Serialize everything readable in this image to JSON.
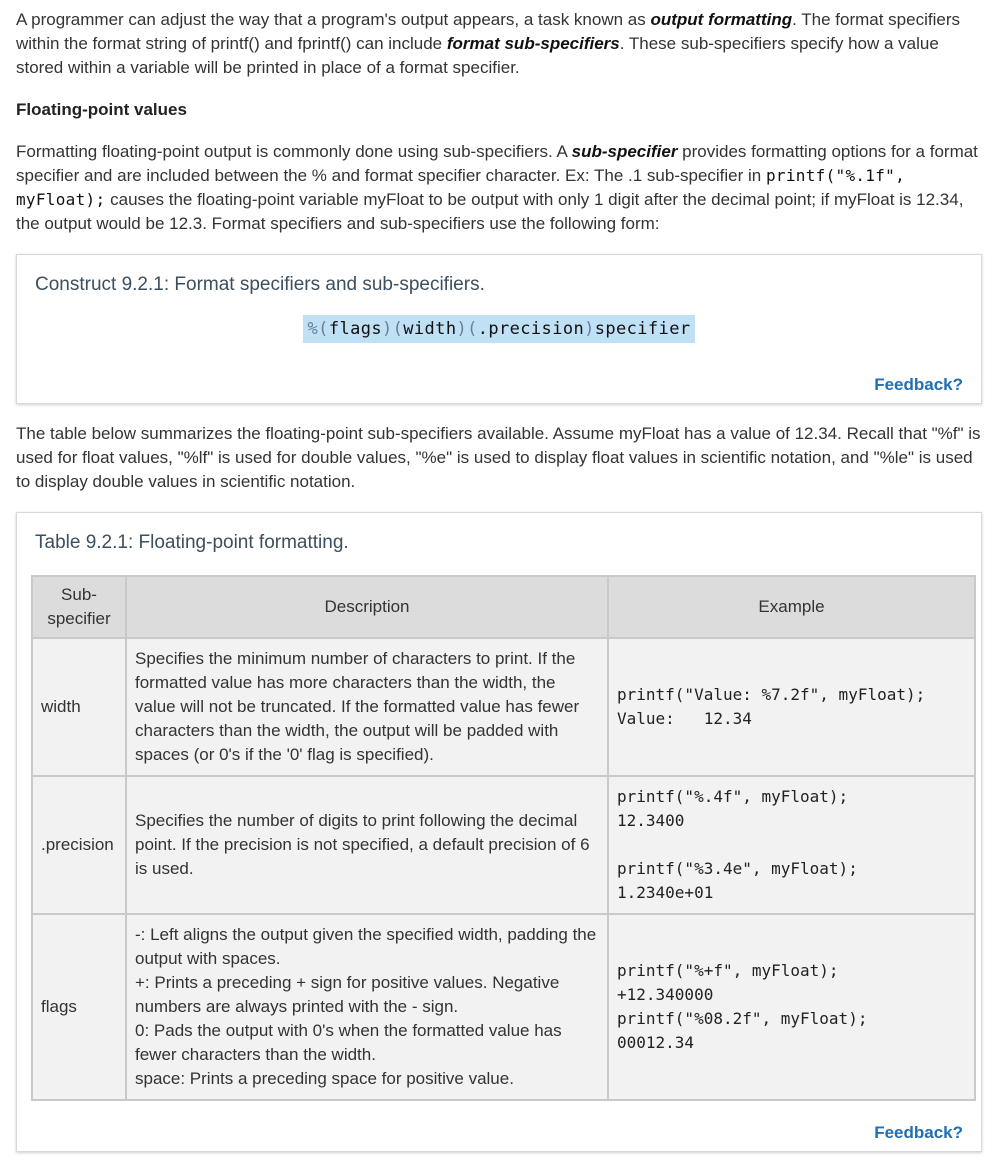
{
  "intro": {
    "t1": "A programmer can adjust the way that a program's output appears, a task known as ",
    "term1": "output formatting",
    "t2": ". The format specifiers within the format string of printf() and fprintf() can include ",
    "term2": "format sub-specifiers",
    "t3": ". These sub-specifiers specify how a value stored within a variable will be printed in place of a format specifier."
  },
  "section_heading": "Floating-point values",
  "para2": {
    "t1": "Formatting floating-point output is commonly done using sub-specifiers. A ",
    "term": "sub-specifier",
    "t2": " provides formatting options for a format specifier and are included between the % and format specifier character. Ex: The .1 sub-specifier in ",
    "code": "printf(\"%.1f\", myFloat);",
    "t3": " causes the floating-point variable myFloat to be output with only 1 digit after the decimal point; if myFloat is 12.34, the output would be 12.3. Format specifiers and sub-specifiers use the following form:"
  },
  "construct": {
    "title": "Construct 9.2.1: Format specifiers and sub-specifiers.",
    "percent": "%",
    "flags": "(flags)",
    "width": "(width)",
    "precision": "(.precision)",
    "specifier": "specifier",
    "feedback": "Feedback?"
  },
  "para3": "The table below summarizes the floating-point sub-specifiers available. Assume myFloat has a value of 12.34. Recall that \"%f\" is used for float values, \"%lf\" is used for double values, \"%e\" is used to display float values in scientific notation, and \"%le\" is used to display double values in scientific notation.",
  "table": {
    "title": "Table 9.2.1: Floating-point formatting.",
    "headers": [
      "Sub-specifier",
      "Description",
      "Example"
    ],
    "rows": [
      {
        "sub": "width",
        "desc": "Specifies the minimum number of characters to print. If the formatted value has more characters than the width, the value will not be truncated. If the formatted value has fewer characters than the width, the output will be padded with spaces (or 0's if the '0' flag is specified).",
        "example": [
          "printf(\"Value: %7.2f\", myFloat);",
          "Value:   12.34"
        ]
      },
      {
        "sub": ".precision",
        "desc": "Specifies the number of digits to print following the decimal point. If the precision is not specified, a default precision of 6 is used.",
        "example": [
          "printf(\"%.4f\", myFloat);",
          "12.3400",
          "",
          "printf(\"%3.4e\", myFloat);",
          "1.2340e+01"
        ]
      },
      {
        "sub": "flags",
        "desc": [
          "-: Left aligns the output given the specified width, padding the output with spaces.",
          "+: Prints a preceding + sign for positive values. Negative numbers are always printed with the - sign.",
          "0: Pads the output with 0's when the formatted value has fewer characters than the width.",
          "space: Prints a preceding space for positive value."
        ],
        "example": [
          "printf(\"%+f\", myFloat);",
          "+12.340000",
          "printf(\"%08.2f\", myFloat);",
          "00012.34"
        ]
      }
    ],
    "feedback": "Feedback?"
  }
}
